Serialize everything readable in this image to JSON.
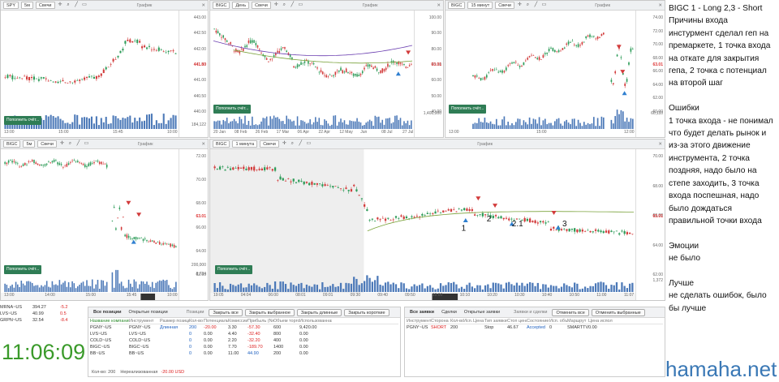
{
  "panels": [
    {
      "symbol": "SPY",
      "interval": "5м",
      "ctype": "Свечи",
      "title": "График",
      "yticks": [
        "443.00",
        "442.50",
        "442.00",
        "441.50",
        "441.00",
        "440.50",
        "440.00"
      ],
      "price": "441.80",
      "xticks": [
        "13:00",
        "15:00",
        "15:45",
        "10:00"
      ],
      "vol": "184,122",
      "fund": "Пополнить счёт..."
    },
    {
      "symbol": "BIGC",
      "interval": "День",
      "ctype": "Свечи",
      "title": "График",
      "yticks": [
        "100.00",
        "90.00",
        "80.00",
        "70.00",
        "60.00",
        "50.00",
        "40.00"
      ],
      "price": "63.01",
      "xticks": [
        "20 Jan",
        "08 Feb",
        "26 Feb",
        "17 Mar",
        "06 Apr",
        "22 Apr",
        "12 May",
        "Jun",
        "08 Jul",
        "27 Jul"
      ],
      "vol": "1,400,000",
      "fund": "Пополнить счёт..."
    },
    {
      "symbol": "BIGC",
      "interval": "15 минут",
      "ctype": "Свечи",
      "title": "График",
      "yticks": [
        "74.00",
        "72.00",
        "70.00",
        "68.00",
        "66.00",
        "64.00",
        "62.00",
        "60.00"
      ],
      "price": "63.01",
      "xticks": [
        "13:00",
        "15:00",
        "12:00"
      ],
      "vol": "60,110",
      "fund": "Пополнить счёт..."
    },
    {
      "symbol": "BIGC",
      "interval": "5м",
      "ctype": "Свечи",
      "title": "График",
      "yticks": [
        "72.00",
        "70.00",
        "68.00",
        "66.00",
        "64.00",
        "62.00"
      ],
      "price": "63.01",
      "xticks": [
        "13:00",
        "14:00",
        "15:00",
        "15:45",
        "10:00"
      ],
      "vol": "200,000",
      "vol2": "8,724",
      "fund": "Пополнить счёт..."
    },
    {
      "symbol": "BIGC",
      "interval": "1 минута",
      "ctype": "Свечи",
      "title": "График",
      "yticks": [
        "70.00",
        "68.00",
        "66.00",
        "64.00",
        "62.00"
      ],
      "price": "63.01",
      "price2": "64.00",
      "xticks": [
        "19:05",
        "04:04",
        "06:00",
        "08:01",
        "09:01",
        "09:30",
        "09:40",
        "09:50",
        "10:00",
        "10:10",
        "10:20",
        "10:30",
        "10:40",
        "10:50",
        "11:00",
        "11:07"
      ],
      "vol": "1,372",
      "fund": "Пополнить счёт...",
      "markers": [
        "1",
        "2",
        "2.1",
        "3"
      ]
    }
  ],
  "notes": [
    "BIGC 1 - Long 2,3 - Short",
    "Причины входа",
    "инстурмент сделал геп на премаркете, 1 точка входа на откате для закрытия гепа, 2 точка с потенциал на второй шаг",
    "",
    "Ошибки",
    "1 точка входа - не понимал что будет делать рынок и из-за этого движение инструмента, 2 точка поздняя, надо было на степе заходить, 3 точка входа поспешная, надо было дождаться правильной точки входа",
    "",
    "Эмоции",
    "не было",
    "",
    "Лучше",
    "не сделать ошибок, было бы лучше"
  ],
  "clock": "11:06:09",
  "watermark": "hamaha.net",
  "watchlist": [
    {
      "sym": "MRNA~US",
      "v1": "394.27",
      "v2": "-5.2"
    },
    {
      "sym": "LVS~US",
      "v1": "40.99",
      "v2": "0.5"
    },
    {
      "sym": "GRPN~US",
      "v1": "32.54",
      "v2": "-8.4"
    }
  ],
  "positions": {
    "tabs": [
      "Все позиции",
      "Открытые позиции"
    ],
    "title": "Позиции",
    "buttons": [
      "Закрыть все",
      "Закрыть выбранное",
      "Закрыть длинные",
      "Закрыть короткие"
    ],
    "headers": [
      "Название компании",
      "Инструмент",
      "Размер позиции",
      "Кол-во",
      "Потенциальная",
      "Комиссии",
      "Прибыль (Net)",
      "Объем торгов",
      "Использованная ПС"
    ],
    "rows": [
      [
        "PGNY~US",
        "PGNY~US",
        "Длинная",
        "200",
        "-20.00",
        "3.30",
        "-57.30",
        "600",
        "9,420.00"
      ],
      [
        "LVS~US",
        "LVS~US",
        "",
        "0",
        "0.00",
        "4.40",
        "-32.40",
        "800",
        "0.00"
      ],
      [
        "COLD~US",
        "COLD~US",
        "",
        "0",
        "0.00",
        "2.20",
        "-32.20",
        "400",
        "0.00"
      ],
      [
        "BIGC~US",
        "BIGC~US",
        "",
        "0",
        "0.00",
        "7.70",
        "-189.70",
        "1400",
        "0.00"
      ],
      [
        "BB~US",
        "BB~US",
        "",
        "0",
        "0.00",
        "11.00",
        "44.90",
        "200",
        "0.00"
      ]
    ],
    "footer_label": "Кол-во: 200",
    "footer_pnl_label": "Нереализованная",
    "footer_pnl": "-20.00 USD"
  },
  "orders": {
    "tabs": [
      "Все заявки",
      "Сделки",
      "Открытые заявки"
    ],
    "title": "Заявки и сделки",
    "buttons": [
      "Отменить все",
      "Отменить выбранные"
    ],
    "headers": [
      "Инструмент",
      "Сторона",
      "Кол-во",
      "Исп.",
      "Цена",
      "Тип заявки",
      "Стоп цена",
      "Состояние",
      "Исп. объем",
      "Маршрут",
      "Цена исполнения"
    ],
    "rows": [
      [
        "PGNY~US",
        "SHORT",
        "200",
        "",
        "",
        "Stop",
        "46.67",
        "Accepted",
        "0",
        "SMARTTV",
        "0.00"
      ]
    ]
  }
}
